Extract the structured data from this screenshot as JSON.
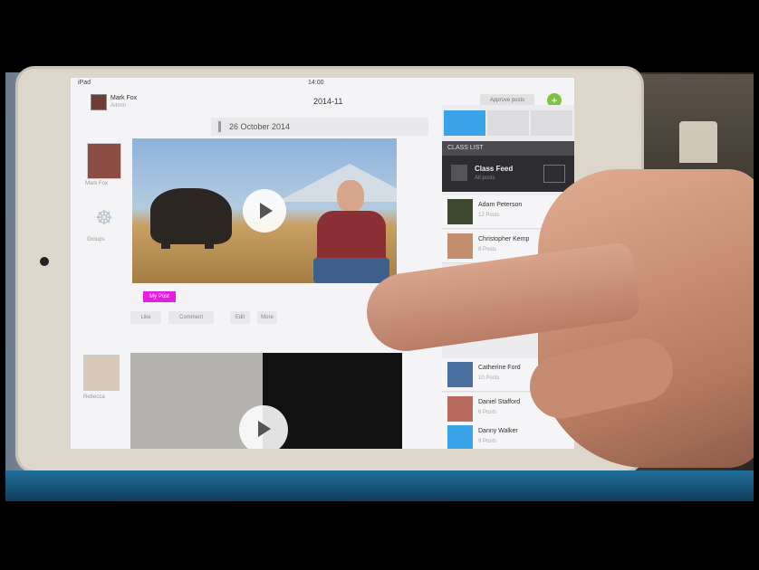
{
  "status_bar": {
    "carrier": "iPad",
    "time": "14:00"
  },
  "header": {
    "user_name": "Mark Fox",
    "user_sub": "Admin",
    "group_title": "2014-11",
    "top_button": "Approve posts",
    "add_button": "+"
  },
  "date_bar": {
    "label": "26 October 2014"
  },
  "left_column": {
    "first_name": "Mark Fox",
    "group_label": "Groups",
    "second_name": "Rebecca"
  },
  "post": {
    "tag": "My Post",
    "actions": [
      "Like",
      "Comment",
      "Edit",
      "More"
    ]
  },
  "sidebar": {
    "tabs": [
      "class",
      "grid",
      "settings"
    ],
    "class_list_header": "CLASS LIST",
    "class_feed": {
      "label": "Class Feed",
      "sub": "All posts"
    },
    "students": [
      {
        "name": "Adam Peterson",
        "sub": "12 Posts"
      },
      {
        "name": "Christopher Kemp",
        "sub": "8 Posts"
      },
      {
        "name": "Catherine Ford",
        "sub": "10 Posts"
      },
      {
        "name": "Daniel Stafford",
        "sub": "6 Posts"
      },
      {
        "name": "Danny Walker",
        "sub": "9 Posts"
      }
    ]
  },
  "icons": {
    "play": "play-icon",
    "group": "group-icon",
    "calendar": "calendar-icon"
  }
}
